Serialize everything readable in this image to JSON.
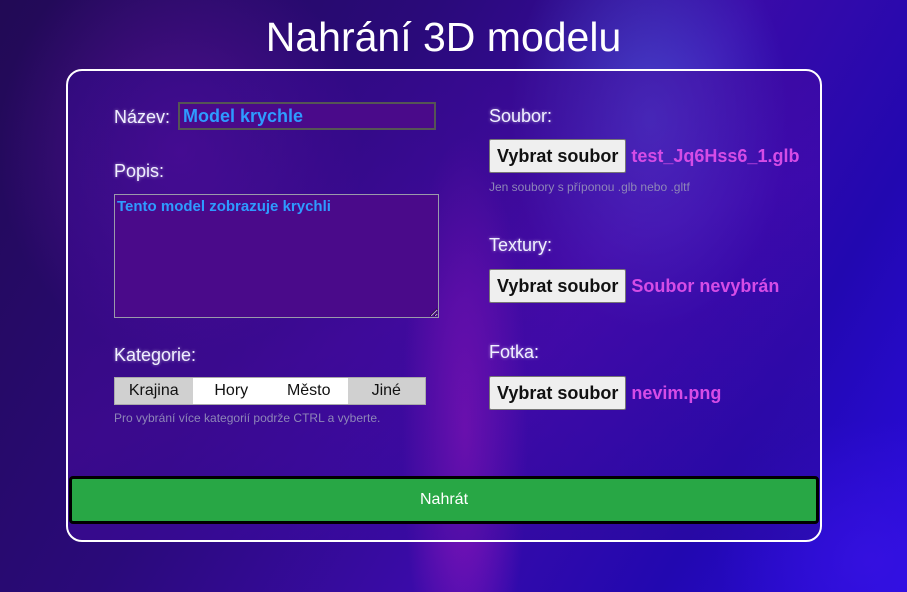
{
  "page": {
    "title": "Nahrání 3D modelu"
  },
  "form": {
    "name_label": "Název:",
    "name_value": "Model krychle",
    "description_label": "Popis:",
    "description_value": "Tento model zobrazuje krychli",
    "category_label": "Kategorie:",
    "category_options": [
      {
        "label": "Krajina",
        "selected": true
      },
      {
        "label": "Hory",
        "selected": false
      },
      {
        "label": "Město",
        "selected": false
      },
      {
        "label": "Jiné",
        "selected": true
      }
    ],
    "category_hint": "Pro vybrání více kategorií podrže CTRL a vyberte.",
    "file_label": "Soubor:",
    "file_button": "Vybrat soubor",
    "file_name": "test_Jq6Hss6_1.glb",
    "file_hint": "Jen soubory s příponou .glb nebo .gltf",
    "textures_label": "Textury:",
    "textures_button": "Vybrat soubor",
    "textures_name": "Soubor nevybrán",
    "photo_label": "Fotka:",
    "photo_button": "Vybrat soubor",
    "photo_name": "nevim.png",
    "submit_label": "Nahrát"
  },
  "colors": {
    "accent_file_name": "#d54ce6",
    "input_text": "#2e9bff",
    "submit_bg": "#28a745"
  }
}
